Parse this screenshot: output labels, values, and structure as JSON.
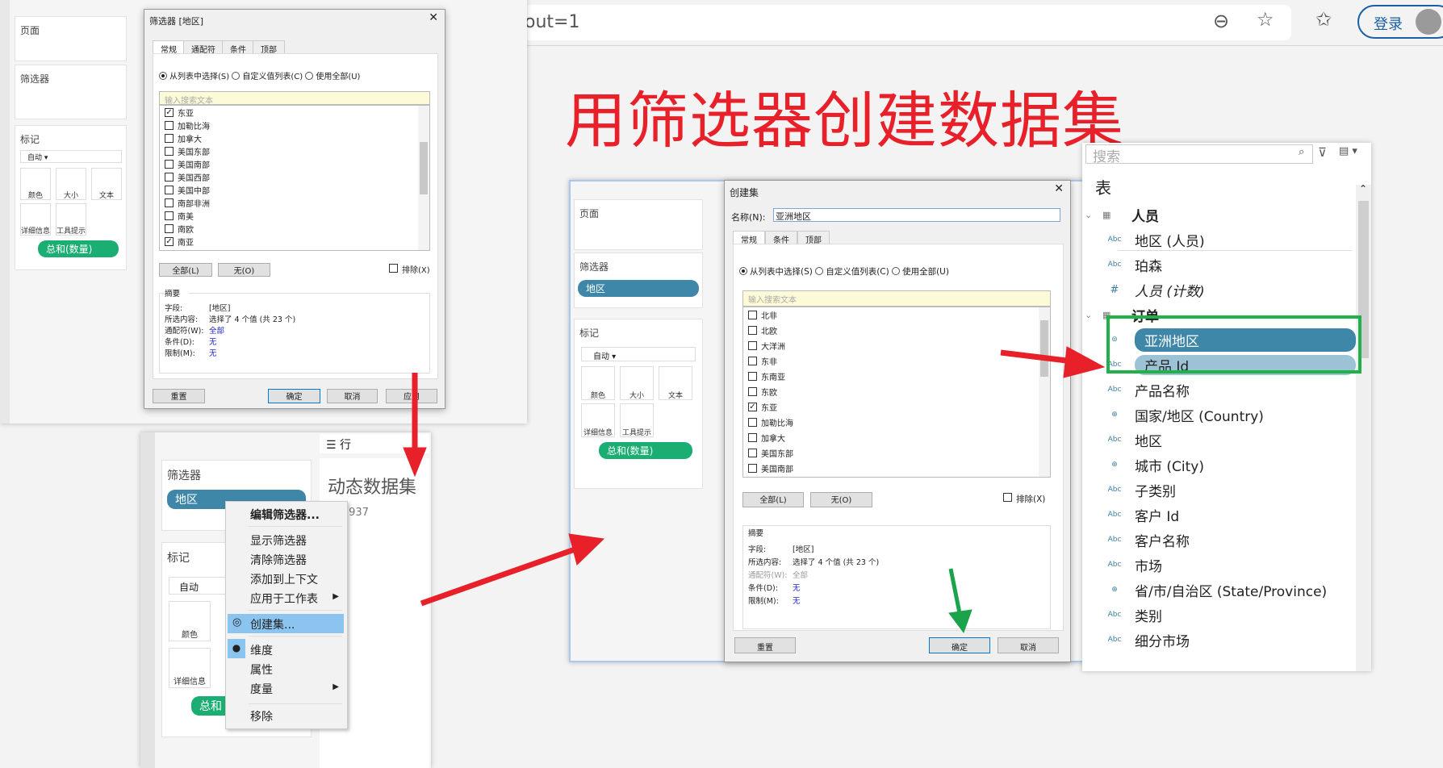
{
  "browser": {
    "address_fragment": "out=1",
    "login_label": "登录",
    "icons": [
      "zoom-out-icon",
      "add-favorite-icon",
      "favorites-icon",
      "avatar"
    ]
  },
  "headline": "用筛选器创建数据集",
  "shot1": {
    "shelves": {
      "pages": "页面",
      "filters": "筛选器",
      "marks": "标记",
      "mark_type": "自动",
      "mark_buttons": [
        "颜色",
        "大小",
        "文本",
        "详细信息",
        "工具提示"
      ],
      "measure_pill": "总和(数量)"
    },
    "dialog": {
      "title": "筛选器 [地区]",
      "tabs": [
        "常规",
        "通配符",
        "条件",
        "顶部"
      ],
      "radios": [
        "从列表中选择(S)",
        "自定义值列表(C)",
        "使用全部(U)"
      ],
      "search_placeholder": "输入搜索文本",
      "items": [
        {
          "label": "东亚",
          "checked": true
        },
        {
          "label": "加勒比海",
          "checked": false
        },
        {
          "label": "加拿大",
          "checked": false
        },
        {
          "label": "美国东部",
          "checked": false
        },
        {
          "label": "美国南部",
          "checked": false
        },
        {
          "label": "美国西部",
          "checked": false
        },
        {
          "label": "美国中部",
          "checked": false
        },
        {
          "label": "南部非洲",
          "checked": false
        },
        {
          "label": "南美",
          "checked": false
        },
        {
          "label": "南欧",
          "checked": false
        },
        {
          "label": "南亚",
          "checked": true
        }
      ],
      "all_label": "全部(L)",
      "none_label": "无(O)",
      "exclude_label": "排除(X)",
      "summary": {
        "title": "摘要",
        "rows": [
          {
            "k": "字段:",
            "v": "[地区]"
          },
          {
            "k": "所选内容:",
            "v": "选择了 4 个值 (共 23 个)"
          },
          {
            "k": "通配符(W):",
            "v": "全部"
          },
          {
            "k": "条件(D):",
            "v": "无"
          },
          {
            "k": "限制(M):",
            "v": "无"
          }
        ]
      },
      "buttons": [
        "重置",
        "确定",
        "取消",
        "应用"
      ]
    }
  },
  "shot2": {
    "filters_title": "筛选器",
    "filter_pill": "地区",
    "marks_title": "标记",
    "mark_type": "自动",
    "mark_buttons": [
      "颜色",
      "详细信息"
    ],
    "measure_pill": "总和",
    "rows_label": "行",
    "sheet_title": "动态数据集",
    "value_fragment": ",937",
    "menu": [
      "编辑筛选器...",
      "显示筛选器",
      "清除筛选器",
      "添加到上下文",
      "应用于工作表",
      "创建集...",
      "维度",
      "属性",
      "度量",
      "移除"
    ]
  },
  "shot3": {
    "shelves": {
      "pages": "页面",
      "filters": "筛选器",
      "filter_pill": "地区",
      "marks": "标记",
      "mark_type": "自动",
      "mark_buttons": [
        "颜色",
        "大小",
        "文本",
        "详细信息",
        "工具提示"
      ],
      "measure_pill": "总和(数量)"
    },
    "dialog": {
      "title": "创建集",
      "name_label": "名称(N):",
      "name_value": "亚洲地区",
      "tabs": [
        "常规",
        "条件",
        "顶部"
      ],
      "radios": [
        "从列表中选择(S)",
        "自定义值列表(C)",
        "使用全部(U)"
      ],
      "search_placeholder": "输入搜索文本",
      "items": [
        {
          "label": "北非",
          "checked": false
        },
        {
          "label": "北欧",
          "checked": false
        },
        {
          "label": "大洋洲",
          "checked": false
        },
        {
          "label": "东非",
          "checked": false
        },
        {
          "label": "东南亚",
          "checked": false
        },
        {
          "label": "东欧",
          "checked": false
        },
        {
          "label": "东亚",
          "checked": true
        },
        {
          "label": "加勒比海",
          "checked": false
        },
        {
          "label": "加拿大",
          "checked": false
        },
        {
          "label": "美国东部",
          "checked": false
        },
        {
          "label": "美国南部",
          "checked": false
        }
      ],
      "all_label": "全部(L)",
      "none_label": "无(O)",
      "exclude_label": "排除(X)",
      "summary": {
        "title": "摘要",
        "rows": [
          {
            "k": "字段:",
            "v": "[地区]"
          },
          {
            "k": "所选内容:",
            "v": "选择了 4 个值 (共 23 个)"
          },
          {
            "k": "通配符(W):",
            "v": "全部"
          },
          {
            "k": "条件(D):",
            "v": "无"
          },
          {
            "k": "限制(M):",
            "v": "无"
          }
        ]
      },
      "buttons": [
        "重置",
        "确定",
        "取消"
      ]
    }
  },
  "data_pane": {
    "search_placeholder": "搜索",
    "section": "表",
    "tables": [
      {
        "name": "人员",
        "fields": [
          {
            "type": "Abc",
            "name": "地区 (人员)"
          },
          {
            "type": "Abc",
            "name": "珀森"
          },
          {
            "type": "#",
            "name": "人员 (计数)"
          }
        ]
      },
      {
        "name": "订单",
        "fields": [
          {
            "type": "set",
            "name": "亚洲地区"
          },
          {
            "type": "Abc",
            "name": "产品 Id"
          },
          {
            "type": "Abc",
            "name": "产品名称"
          },
          {
            "type": "geo",
            "name": "国家/地区 (Country)"
          },
          {
            "type": "Abc",
            "name": "地区"
          },
          {
            "type": "geo",
            "name": "城市 (City)"
          },
          {
            "type": "Abc",
            "name": "子类别"
          },
          {
            "type": "Abc",
            "name": "客户 Id"
          },
          {
            "type": "Abc",
            "name": "客户名称"
          },
          {
            "type": "Abc",
            "name": "市场"
          },
          {
            "type": "geo",
            "name": "省/市/自治区 (State/Province)"
          },
          {
            "type": "Abc",
            "name": "类别"
          },
          {
            "type": "Abc",
            "name": "细分市场"
          }
        ]
      }
    ]
  },
  "colors": {
    "arrow_red": "#e8202a",
    "arrow_green": "#1aa34a",
    "pill_blue": "#3e87a8",
    "pill_green": "#1bae73",
    "highlight_box": "#22b04b"
  }
}
